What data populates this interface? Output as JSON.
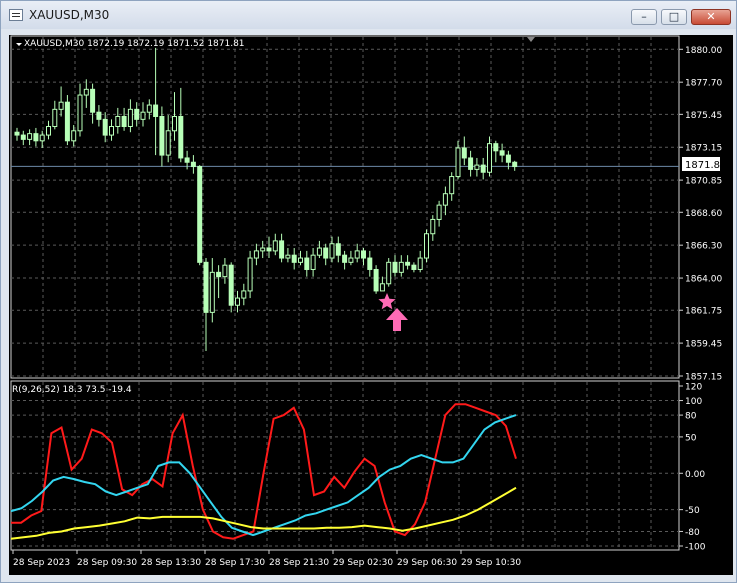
{
  "window": {
    "title": "XAUUSD,M30",
    "minimize_glyph": "–",
    "maximize_glyph": "□",
    "close_glyph": "✕"
  },
  "main_header": "XAUUSD,M30  1872.19 1872.19 1871.52 1871.81",
  "indicator_header": "R(9,26,52) 18.3 73.5 -19.4",
  "current_price_label": "1871.81",
  "colors": {
    "background": "#000000",
    "grid": "#5a5a5a",
    "candle_bull": "#b8ffb8",
    "candle_bear": "#b8ffb8",
    "text": "#ffffff",
    "red_line": "#ff1a1a",
    "cyan_line": "#33d6f0",
    "yellow_line": "#ffff33",
    "marker": "#ff6bb5"
  },
  "chart_data": [
    {
      "type": "candlestick",
      "title": "XAUUSD,M30",
      "ylim": [
        1857.15,
        1880.3
      ],
      "y_ticks": [
        "1880.00",
        "1877.70",
        "1875.45",
        "1873.15",
        "1870.85",
        "1868.60",
        "1866.30",
        "1864.00",
        "1861.75",
        "1859.45",
        "1857.15"
      ],
      "x_ticks": [
        "28 Sep 2023",
        "28 Sep 09:30",
        "28 Sep 13:30",
        "28 Sep 17:30",
        "28 Sep 21:30",
        "29 Sep 02:30",
        "29 Sep 06:30",
        "29 Sep 10:30"
      ],
      "current_price": 1871.81,
      "candles": [
        [
          1874.2,
          1874.0,
          1874.5,
          1873.6
        ],
        [
          1874.0,
          1873.7,
          1874.3,
          1873.3
        ],
        [
          1873.7,
          1874.1,
          1874.4,
          1873.3
        ],
        [
          1874.1,
          1873.6,
          1874.5,
          1873.2
        ],
        [
          1873.6,
          1874.0,
          1874.3,
          1873.1
        ],
        [
          1874.0,
          1874.6,
          1875.0,
          1873.7
        ],
        [
          1874.6,
          1875.8,
          1876.4,
          1874.4
        ],
        [
          1875.8,
          1876.3,
          1877.4,
          1875.3
        ],
        [
          1876.3,
          1873.6,
          1876.8,
          1873.3
        ],
        [
          1873.6,
          1874.3,
          1874.7,
          1873.2
        ],
        [
          1874.3,
          1876.8,
          1877.6,
          1873.9
        ],
        [
          1876.8,
          1877.2,
          1877.9,
          1875.9
        ],
        [
          1877.2,
          1875.6,
          1877.6,
          1874.8
        ],
        [
          1875.6,
          1875.1,
          1876.1,
          1874.6
        ],
        [
          1875.1,
          1874.0,
          1875.6,
          1873.5
        ],
        [
          1874.0,
          1874.6,
          1875.1,
          1873.6
        ],
        [
          1874.6,
          1875.3,
          1875.9,
          1874.1
        ],
        [
          1875.3,
          1874.6,
          1875.9,
          1874.3
        ],
        [
          1874.6,
          1875.8,
          1876.5,
          1874.2
        ],
        [
          1875.8,
          1875.1,
          1876.3,
          1874.6
        ],
        [
          1875.1,
          1875.6,
          1876.3,
          1874.6
        ],
        [
          1875.6,
          1876.1,
          1876.5,
          1875.1
        ],
        [
          1876.1,
          1875.3,
          1880.1,
          1872.6
        ],
        [
          1875.3,
          1872.6,
          1876.0,
          1871.8
        ],
        [
          1872.6,
          1874.3,
          1875.4,
          1872.1
        ],
        [
          1874.3,
          1875.3,
          1877.0,
          1873.6
        ],
        [
          1875.3,
          1872.4,
          1877.3,
          1872.1
        ],
        [
          1872.4,
          1872.1,
          1872.9,
          1871.6
        ],
        [
          1872.1,
          1871.8,
          1872.6,
          1871.3
        ],
        [
          1871.8,
          1865.1,
          1871.9,
          1864.9
        ],
        [
          1865.1,
          1861.6,
          1865.4,
          1858.9
        ],
        [
          1861.6,
          1864.4,
          1865.4,
          1860.9
        ],
        [
          1864.4,
          1864.1,
          1864.9,
          1862.6
        ],
        [
          1864.1,
          1864.9,
          1865.4,
          1863.6
        ],
        [
          1864.9,
          1862.1,
          1865.1,
          1861.6
        ],
        [
          1862.1,
          1862.6,
          1863.1,
          1861.6
        ],
        [
          1862.6,
          1863.1,
          1863.6,
          1862.1
        ],
        [
          1863.1,
          1865.4,
          1865.9,
          1862.6
        ],
        [
          1865.4,
          1865.9,
          1866.4,
          1864.9
        ],
        [
          1865.9,
          1866.1,
          1866.6,
          1865.4
        ],
        [
          1866.1,
          1865.9,
          1866.9,
          1865.4
        ],
        [
          1865.9,
          1866.6,
          1867.1,
          1865.6
        ],
        [
          1866.6,
          1865.4,
          1867.1,
          1865.1
        ],
        [
          1865.4,
          1865.6,
          1866.1,
          1865.1
        ],
        [
          1865.6,
          1865.1,
          1866.1,
          1864.6
        ],
        [
          1865.1,
          1865.4,
          1865.9,
          1864.9
        ],
        [
          1865.4,
          1864.6,
          1865.9,
          1864.1
        ],
        [
          1864.6,
          1865.6,
          1866.1,
          1864.1
        ],
        [
          1865.6,
          1866.1,
          1866.6,
          1865.4
        ],
        [
          1866.1,
          1865.4,
          1866.4,
          1864.9
        ],
        [
          1865.4,
          1866.4,
          1866.9,
          1865.1
        ],
        [
          1866.4,
          1865.6,
          1866.9,
          1865.1
        ],
        [
          1865.6,
          1865.1,
          1865.9,
          1864.6
        ],
        [
          1865.1,
          1865.4,
          1865.9,
          1864.9
        ],
        [
          1865.4,
          1865.9,
          1866.4,
          1865.1
        ],
        [
          1865.9,
          1865.4,
          1866.1,
          1864.9
        ],
        [
          1865.4,
          1864.6,
          1865.9,
          1864.1
        ],
        [
          1864.6,
          1863.1,
          1864.9,
          1862.9
        ],
        [
          1863.1,
          1863.6,
          1864.1,
          1863.1
        ],
        [
          1863.6,
          1865.1,
          1865.4,
          1863.4
        ],
        [
          1865.1,
          1864.4,
          1865.6,
          1864.1
        ],
        [
          1864.4,
          1865.1,
          1865.6,
          1864.1
        ],
        [
          1865.1,
          1864.9,
          1865.6,
          1864.6
        ],
        [
          1864.9,
          1864.6,
          1865.1,
          1864.4
        ],
        [
          1864.6,
          1865.4,
          1865.9,
          1864.4
        ],
        [
          1865.4,
          1867.1,
          1867.4,
          1865.1
        ],
        [
          1867.1,
          1868.1,
          1868.4,
          1866.6
        ],
        [
          1868.1,
          1869.1,
          1869.4,
          1867.6
        ],
        [
          1869.1,
          1869.9,
          1870.4,
          1868.4
        ],
        [
          1869.9,
          1871.1,
          1871.4,
          1869.4
        ],
        [
          1871.1,
          1873.1,
          1873.6,
          1870.9
        ],
        [
          1873.1,
          1872.4,
          1873.9,
          1871.9
        ],
        [
          1872.4,
          1871.6,
          1872.9,
          1871.1
        ],
        [
          1871.6,
          1871.9,
          1872.4,
          1871.1
        ],
        [
          1871.9,
          1871.4,
          1872.4,
          1870.9
        ],
        [
          1871.4,
          1873.4,
          1873.9,
          1871.1
        ],
        [
          1873.4,
          1872.9,
          1873.6,
          1872.1
        ],
        [
          1872.9,
          1872.6,
          1873.4,
          1872.1
        ],
        [
          1872.6,
          1872.1,
          1872.9,
          1871.6
        ],
        [
          1872.1,
          1871.8,
          1872.2,
          1871.5
        ]
      ]
    },
    {
      "type": "line",
      "title": "R(9,26,52) 18.3 73.5 -19.4",
      "ylim": [
        -100,
        120
      ],
      "y_ticks": [
        "120",
        "100",
        "80",
        "50",
        "0.00",
        "-50",
        "-80",
        "-100"
      ],
      "series": [
        {
          "color": "red",
          "values": [
            -68,
            -68,
            -58,
            -52,
            55,
            63,
            5,
            20,
            60,
            55,
            42,
            -22,
            -30,
            -15,
            -8,
            -18,
            55,
            80,
            10,
            -50,
            -80,
            -88,
            -90,
            -85,
            -80,
            0,
            75,
            80,
            90,
            60,
            -30,
            -25,
            -5,
            -20,
            2,
            20,
            10,
            -40,
            -80,
            -85,
            -70,
            -40,
            20,
            80,
            95,
            95,
            90,
            85,
            80,
            65,
            20
          ]
        },
        {
          "color": "cyan",
          "values": [
            -52,
            -48,
            -38,
            -25,
            -10,
            -5,
            -8,
            -12,
            -15,
            -25,
            -30,
            -25,
            -20,
            -15,
            10,
            15,
            15,
            0,
            -20,
            -40,
            -60,
            -75,
            -80,
            -85,
            -80,
            -75,
            -70,
            -65,
            -58,
            -55,
            -50,
            -45,
            -40,
            -30,
            -20,
            -5,
            5,
            10,
            20,
            25,
            20,
            15,
            15,
            20,
            40,
            60,
            70,
            75,
            80
          ]
        },
        {
          "color": "yellow",
          "values": [
            -90,
            -88,
            -86,
            -82,
            -80,
            -76,
            -74,
            -72,
            -69,
            -66,
            -61,
            -62,
            -60,
            -60,
            -60,
            -60,
            -62,
            -66,
            -70,
            -74,
            -76,
            -76,
            -76,
            -76,
            -76,
            -75,
            -75,
            -74,
            -72,
            -74,
            -76,
            -79,
            -76,
            -72,
            -68,
            -64,
            -58,
            -50,
            -40,
            -30,
            -20
          ]
        }
      ]
    }
  ]
}
